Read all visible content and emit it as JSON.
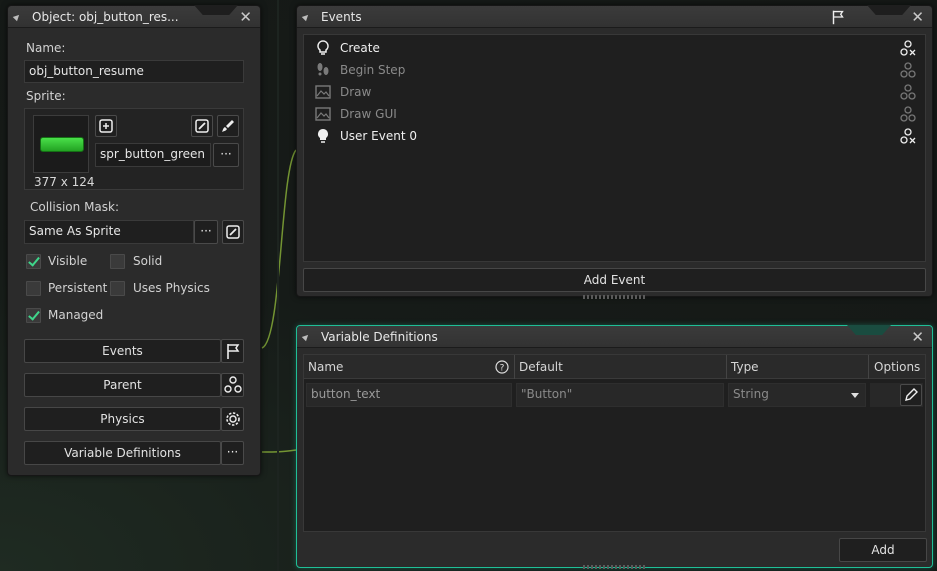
{
  "object_panel": {
    "title": "Object: obj_button_res...",
    "name_label": "Name:",
    "name_value": "obj_button_resume",
    "sprite_label": "Sprite:",
    "sprite_name": "spr_button_green",
    "sprite_size": "377 x 124",
    "sprite_color": "#2fbf2f",
    "collision_label": "Collision Mask:",
    "collision_value": "Same As Sprite",
    "more_label": "···",
    "checkboxes": {
      "visible": "Visible",
      "solid": "Solid",
      "persistent": "Persistent",
      "uses_physics": "Uses Physics",
      "managed": "Managed"
    },
    "buttons": {
      "events": "Events",
      "parent": "Parent",
      "physics": "Physics",
      "variable_definitions": "Variable Definitions"
    }
  },
  "events_panel": {
    "title": "Events",
    "items": [
      {
        "label": "Create",
        "active": true
      },
      {
        "label": "Begin Step",
        "active": false
      },
      {
        "label": "Draw",
        "active": false
      },
      {
        "label": "Draw GUI",
        "active": false
      },
      {
        "label": "User Event 0",
        "active": true
      }
    ],
    "add_button": "Add Event"
  },
  "vardef_panel": {
    "title": "Variable Definitions",
    "columns": [
      "Name",
      "Default",
      "Type",
      "Options"
    ],
    "rows": [
      {
        "name": "button_text",
        "default": "\"Button\"",
        "type": "String"
      }
    ],
    "add_button": "Add"
  },
  "colors": {
    "accent": "#1fbf97",
    "check": "#3fd68b"
  }
}
